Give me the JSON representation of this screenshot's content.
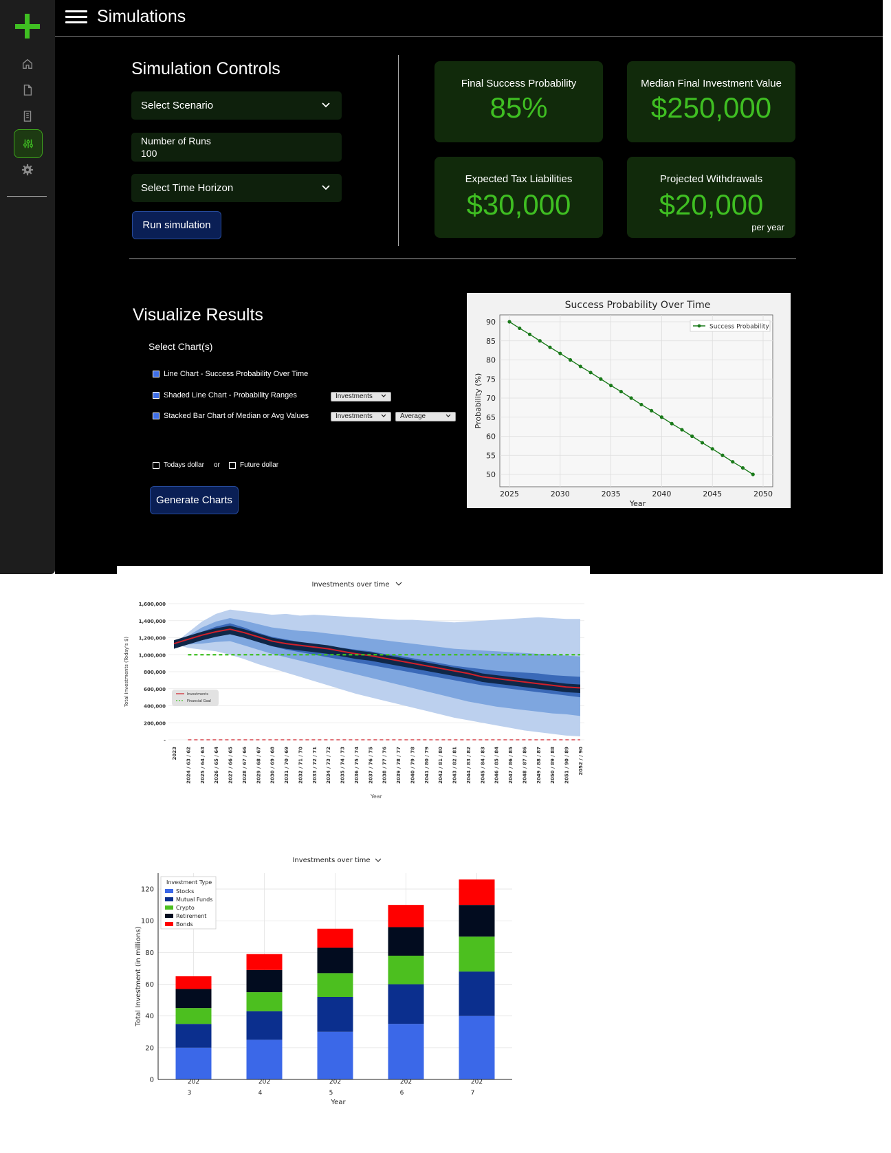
{
  "header": {
    "title": "Simulations"
  },
  "sidebar": {
    "items": [
      "home-icon",
      "document-icon",
      "receipt-icon",
      "sliders-icon",
      "gear-icon"
    ],
    "active": "sliders-icon"
  },
  "controls": {
    "heading": "Simulation Controls",
    "scenario_label": "Select Scenario",
    "runs_label": "Number of Runs",
    "runs_value": "100",
    "horizon_label": "Select Time Horizon",
    "run_button": "Run simulation"
  },
  "cards": [
    {
      "title": "Final Success Probability",
      "value": "85%",
      "sub": ""
    },
    {
      "title": "Median Final Investment Value",
      "value": "$250,000",
      "sub": ""
    },
    {
      "title": "Expected Tax Liabilities",
      "value": "$30,000",
      "sub": ""
    },
    {
      "title": "Projected Withdrawals",
      "value": "$20,000",
      "sub": "per year"
    }
  ],
  "visualize": {
    "heading": "Visualize Results",
    "select_label": "Select Chart(s)",
    "options": [
      "Line Chart - Success Probability Over Time",
      "Shaded Line Chart - Probability Ranges",
      "Stacked Bar Chart of Median or Avg Values"
    ],
    "shaded_dropdown": "Investments",
    "stacked_dropdown_1": "Investments",
    "stacked_dropdown_2": "Average",
    "todays_dollar": "Todays dollar",
    "or": "or",
    "future_dollar": "Future dollar",
    "generate_button": "Generate Charts"
  },
  "colors": {
    "accent": "#3fbf22",
    "card_bg": "#112a0b",
    "button_bg": "#0a1f55"
  },
  "chart_data": [
    {
      "type": "line",
      "title": "Success Probability Over Time",
      "xlabel": "Year",
      "ylabel": "Probability (%)",
      "legend": "Success Probability",
      "legend_position": "top-right",
      "xlim": [
        2025,
        2050
      ],
      "ylim": [
        50,
        90
      ],
      "xticks": [
        "2025",
        "2030",
        "2035",
        "2040",
        "2045",
        "2050"
      ],
      "yticks": [
        "50",
        "55",
        "60",
        "65",
        "70",
        "75",
        "80",
        "85",
        "90"
      ],
      "x": [
        2025,
        2026,
        2027,
        2028,
        2029,
        2030,
        2031,
        2032,
        2033,
        2034,
        2035,
        2036,
        2037,
        2038,
        2039,
        2040,
        2041,
        2042,
        2043,
        2044,
        2045,
        2046,
        2047,
        2048,
        2049
      ],
      "y": [
        90,
        88.3,
        86.7,
        85,
        83.3,
        81.7,
        80,
        78.3,
        76.7,
        75,
        73.3,
        71.7,
        70,
        68.3,
        66.7,
        65,
        63.3,
        61.7,
        60,
        58.3,
        56.7,
        55,
        53.3,
        51.7,
        50
      ],
      "grid": true
    },
    {
      "type": "area",
      "title": "Investments over time",
      "xlabel": "Year",
      "ylabel": "Total Investments (Today's $)",
      "yticks": [
        "-",
        "200,000",
        "400,000",
        "600,000",
        "800,000",
        "1,000,000",
        "1,200,000",
        "1,400,000",
        "1,600,000"
      ],
      "x": [
        "2023",
        "2024 / 63 / 62",
        "2025 / 64 / 63",
        "2026 / 65 / 64",
        "2027 / 66 / 65",
        "2028 / 67 / 66",
        "2029 / 68 / 67",
        "2030 / 69 / 68",
        "2031 / 70 / 69",
        "2032 / 71 / 70",
        "2033 / 72 / 71",
        "2034 / 73 / 72",
        "2035 / 74 / 73",
        "2036 / 75 / 74",
        "2037 / 76 / 75",
        "2038 / 77 / 76",
        "2039 / 78 / 77",
        "2040 / 79 / 78",
        "2041 / 80 / 79",
        "2042 / 81 / 80",
        "2043 / 82 / 81",
        "2044 / 83 / 82",
        "2045 / 84 / 83",
        "2046 / 85 / 84",
        "2047 / 86 / 85",
        "2048 / 87 / 86",
        "2049 / 88 / 87",
        "2050 / 89 / 88",
        "2051 / 90 / 89",
        "2052 / / 90"
      ],
      "series": [
        {
          "name": "Investments",
          "values": [
            1130000,
            1180000,
            1230000,
            1270000,
            1300000,
            1260000,
            1210000,
            1160000,
            1130000,
            1110000,
            1090000,
            1070000,
            1040000,
            1010000,
            990000,
            960000,
            930000,
            900000,
            870000,
            840000,
            810000,
            780000,
            740000,
            720000,
            700000,
            680000,
            660000,
            640000,
            620000,
            610000
          ]
        },
        {
          "name": "Financial Goal",
          "values": [
            null,
            1000000,
            1000000,
            1000000,
            1000000,
            1000000,
            1000000,
            1000000,
            1000000,
            1000000,
            1000000,
            1000000,
            1000000,
            1000000,
            1000000,
            1000000,
            1000000,
            1000000,
            1000000,
            1000000,
            1000000,
            1000000,
            1000000,
            1000000,
            1000000,
            1000000,
            1000000,
            1000000,
            1000000,
            1000000
          ]
        }
      ],
      "bands": {
        "outer_hi": [
          1130000,
          1260000,
          1390000,
          1480000,
          1530000,
          1510000,
          1490000,
          1470000,
          1480000,
          1460000,
          1470000,
          1460000,
          1450000,
          1440000,
          1430000,
          1420000,
          1410000,
          1410000,
          1400000,
          1390000,
          1380000,
          1390000,
          1400000,
          1410000,
          1420000,
          1430000,
          1440000,
          1430000,
          1420000,
          1420000
        ],
        "mid_hi": [
          1130000,
          1220000,
          1320000,
          1390000,
          1430000,
          1400000,
          1360000,
          1320000,
          1300000,
          1280000,
          1270000,
          1250000,
          1230000,
          1210000,
          1190000,
          1170000,
          1150000,
          1130000,
          1110000,
          1090000,
          1070000,
          1060000,
          1050000,
          1040000,
          1030000,
          1020000,
          1010000,
          1000000,
          990000,
          980000
        ],
        "in_hi": [
          1130000,
          1200000,
          1270000,
          1330000,
          1370000,
          1320000,
          1260000,
          1210000,
          1180000,
          1150000,
          1120000,
          1100000,
          1080000,
          1060000,
          1040000,
          1010000,
          990000,
          960000,
          930000,
          900000,
          870000,
          850000,
          830000,
          810000,
          800000,
          790000,
          780000,
          760000,
          750000,
          740000
        ],
        "in_lo": [
          1130000,
          1150000,
          1190000,
          1220000,
          1250000,
          1200000,
          1150000,
          1100000,
          1060000,
          1030000,
          1000000,
          970000,
          940000,
          910000,
          880000,
          850000,
          820000,
          790000,
          760000,
          730000,
          700000,
          670000,
          640000,
          620000,
          600000,
          580000,
          560000,
          540000,
          520000,
          500000
        ],
        "mid_lo": [
          1130000,
          1120000,
          1130000,
          1150000,
          1160000,
          1110000,
          1060000,
          1010000,
          970000,
          930000,
          890000,
          850000,
          810000,
          770000,
          730000,
          690000,
          650000,
          610000,
          570000,
          530000,
          490000,
          450000,
          420000,
          390000,
          370000,
          350000,
          330000,
          310000,
          300000,
          280000
        ],
        "outer_lo": [
          1130000,
          1080000,
          1060000,
          1040000,
          1000000,
          950000,
          890000,
          840000,
          790000,
          740000,
          690000,
          640000,
          590000,
          540000,
          500000,
          460000,
          420000,
          380000,
          340000,
          300000,
          260000,
          230000,
          200000,
          170000,
          140000,
          110000,
          90000,
          70000,
          50000,
          40000
        ]
      }
    },
    {
      "type": "bar",
      "title": "Investments over time",
      "xlabel": "Year",
      "ylabel": "Total Investment (in millions)",
      "ylim": [
        0,
        130
      ],
      "yticks": [
        "0",
        "20",
        "40",
        "60",
        "80",
        "100",
        "120"
      ],
      "categories": [
        "202\n3",
        "202\n4",
        "202\n5",
        "202\n6",
        "202\n7"
      ],
      "legend_title": "Investment Type",
      "legend_position": "top-left",
      "series": [
        {
          "name": "Stocks",
          "color": "#3b68e8",
          "values": [
            20,
            25,
            30,
            35,
            40
          ]
        },
        {
          "name": "Mutual Funds",
          "color": "#0b2f8e",
          "values": [
            15,
            18,
            22,
            25,
            28
          ]
        },
        {
          "name": "Crypto",
          "color": "#4cbf1f",
          "values": [
            10,
            12,
            15,
            18,
            22
          ]
        },
        {
          "name": "Retirement",
          "color": "#020c1f",
          "values": [
            12,
            14,
            16,
            18,
            20
          ]
        },
        {
          "name": "Bonds",
          "color": "#ff0000",
          "values": [
            8,
            10,
            12,
            14,
            16
          ]
        }
      ]
    }
  ]
}
